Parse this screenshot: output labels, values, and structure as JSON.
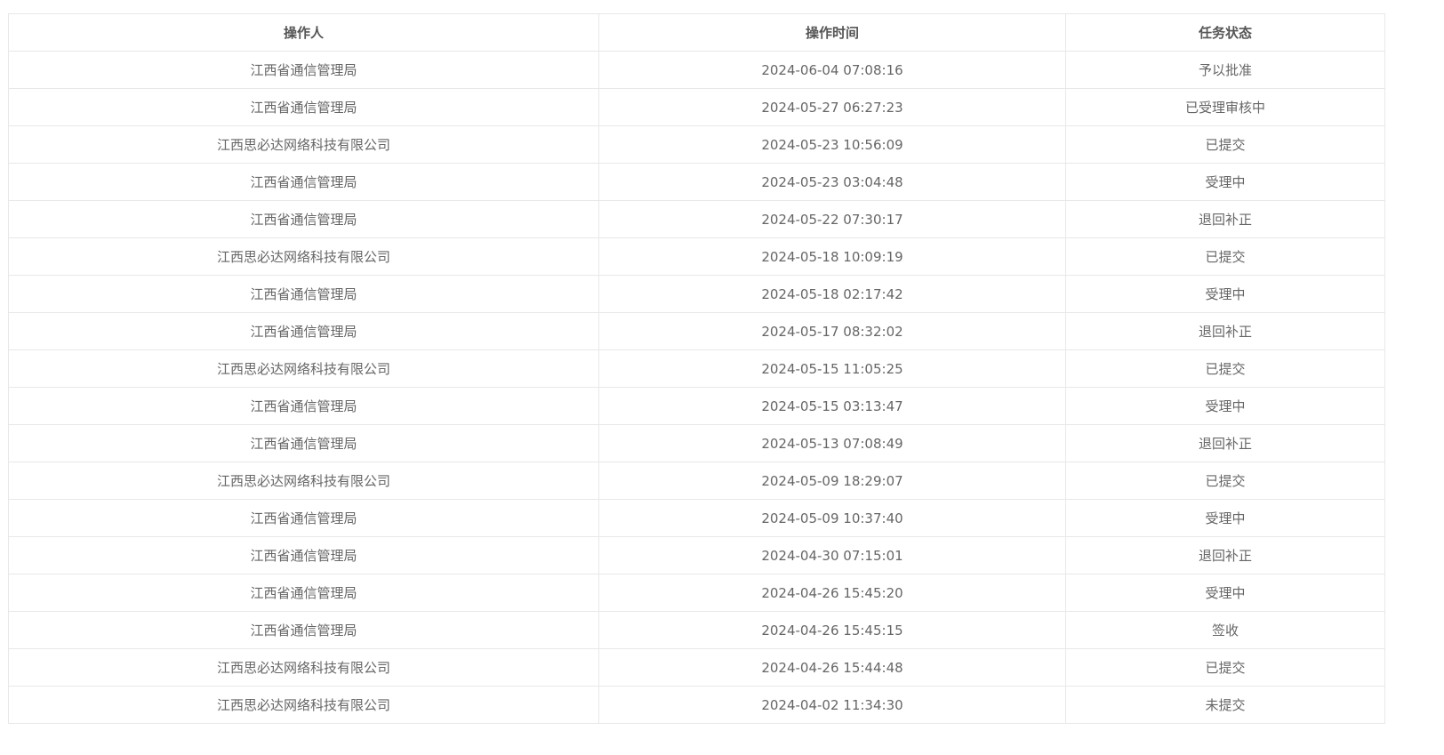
{
  "table": {
    "headers": [
      "操作人",
      "操作时间",
      "任务状态"
    ],
    "rows": [
      {
        "operator": "江西省通信管理局",
        "time": "2024-06-04 07:08:16",
        "status": "予以批准"
      },
      {
        "operator": "江西省通信管理局",
        "time": "2024-05-27 06:27:23",
        "status": "已受理审核中"
      },
      {
        "operator": "江西思必达网络科技有限公司",
        "time": "2024-05-23 10:56:09",
        "status": "已提交"
      },
      {
        "operator": "江西省通信管理局",
        "time": "2024-05-23 03:04:48",
        "status": "受理中"
      },
      {
        "operator": "江西省通信管理局",
        "time": "2024-05-22 07:30:17",
        "status": "退回补正"
      },
      {
        "operator": "江西思必达网络科技有限公司",
        "time": "2024-05-18 10:09:19",
        "status": "已提交"
      },
      {
        "operator": "江西省通信管理局",
        "time": "2024-05-18 02:17:42",
        "status": "受理中"
      },
      {
        "operator": "江西省通信管理局",
        "time": "2024-05-17 08:32:02",
        "status": "退回补正"
      },
      {
        "operator": "江西思必达网络科技有限公司",
        "time": "2024-05-15 11:05:25",
        "status": "已提交"
      },
      {
        "operator": "江西省通信管理局",
        "time": "2024-05-15 03:13:47",
        "status": "受理中"
      },
      {
        "operator": "江西省通信管理局",
        "time": "2024-05-13 07:08:49",
        "status": "退回补正"
      },
      {
        "operator": "江西思必达网络科技有限公司",
        "time": "2024-05-09 18:29:07",
        "status": "已提交"
      },
      {
        "operator": "江西省通信管理局",
        "time": "2024-05-09 10:37:40",
        "status": "受理中"
      },
      {
        "operator": "江西省通信管理局",
        "time": "2024-04-30 07:15:01",
        "status": "退回补正"
      },
      {
        "operator": "江西省通信管理局",
        "time": "2024-04-26 15:45:20",
        "status": "受理中"
      },
      {
        "operator": "江西省通信管理局",
        "time": "2024-04-26 15:45:15",
        "status": "签收"
      },
      {
        "operator": "江西思必达网络科技有限公司",
        "time": "2024-04-26 15:44:48",
        "status": "已提交"
      },
      {
        "operator": "江西思必达网络科技有限公司",
        "time": "2024-04-02 11:34:30",
        "status": "未提交"
      }
    ]
  }
}
